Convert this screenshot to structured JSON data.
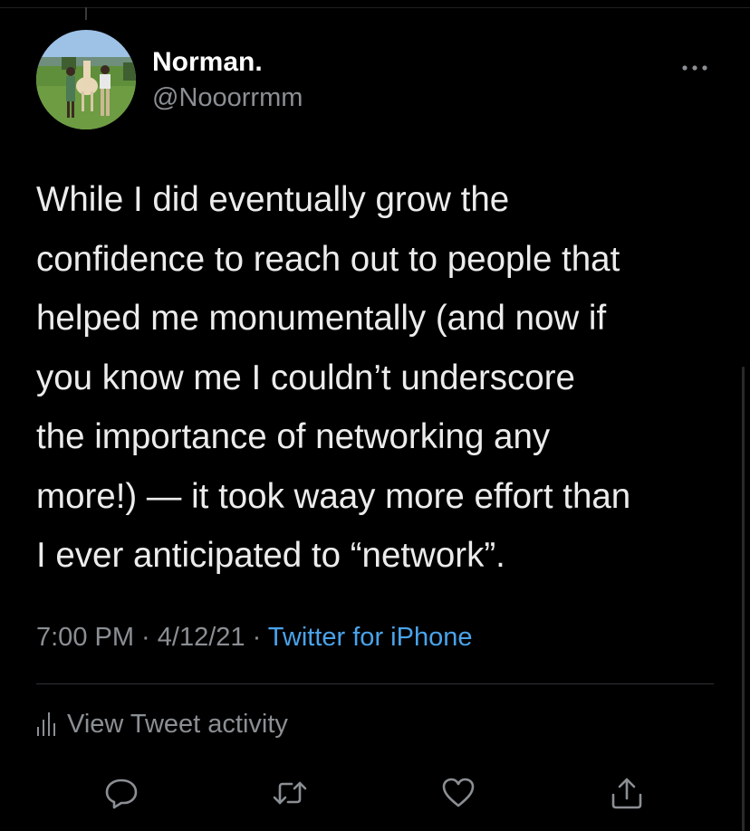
{
  "author": {
    "name": "Norman.",
    "handle": "@Nooorrmm"
  },
  "tweet": {
    "lines": [
      "While I did eventually grow the",
      "confidence to reach out to people that",
      "helped me monumentally (and now if",
      "you know me I couldn’t underscore",
      "the importance of networking any",
      "more!) — it took waay more effort than",
      "I ever anticipated to “network”."
    ]
  },
  "meta": {
    "time": "7:00 PM",
    "sep1": " · ",
    "date": "4/12/21",
    "sep2": " · ",
    "source": "Twitter for iPhone"
  },
  "activity": {
    "label": "View Tweet activity"
  },
  "icons": {
    "more": "more-options-icon",
    "activity": "bar-chart-icon",
    "reply": "reply-icon",
    "retweet": "retweet-icon",
    "like": "heart-icon",
    "share": "share-icon"
  },
  "colors": {
    "background": "#000000",
    "text": "#e7e9ea",
    "secondary": "#8b8f94",
    "link": "#4aa3ea"
  }
}
